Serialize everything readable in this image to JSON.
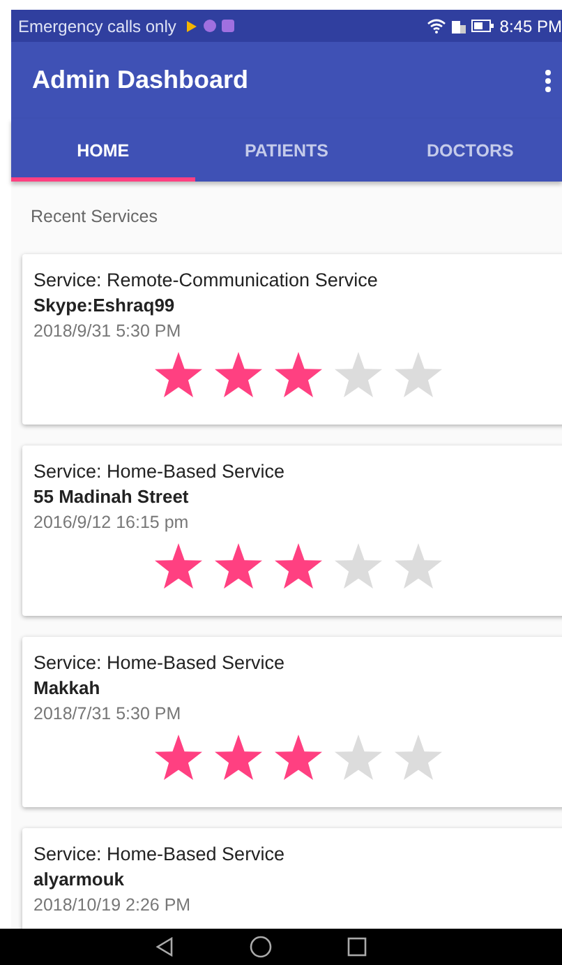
{
  "status_bar": {
    "text": "Emergency calls only",
    "time": "8:45 PM"
  },
  "app_bar": {
    "title": "Admin Dashboard"
  },
  "tabs": [
    {
      "label": "HOME",
      "selected": true
    },
    {
      "label": "PATIENTS",
      "selected": false
    },
    {
      "label": "DOCTORS",
      "selected": false
    }
  ],
  "section_title": "Recent Services",
  "services": [
    {
      "service": "Service: Remote-Communication Service",
      "location": "Skype:Eshraq99",
      "date": "2018/9/31 5:30 PM",
      "stars": 3
    },
    {
      "service": "Service: Home-Based Service",
      "location": "55 Madinah Street",
      "date": "2016/9/12 16:15 pm",
      "stars": 3
    },
    {
      "service": "Service: Home-Based Service",
      "location": "Makkah",
      "date": "2018/7/31 5:30 PM",
      "stars": 3
    },
    {
      "service": "Service: Home-Based Service",
      "location": "alyarmouk",
      "date": "2018/10/19 2:26 PM"
    }
  ]
}
